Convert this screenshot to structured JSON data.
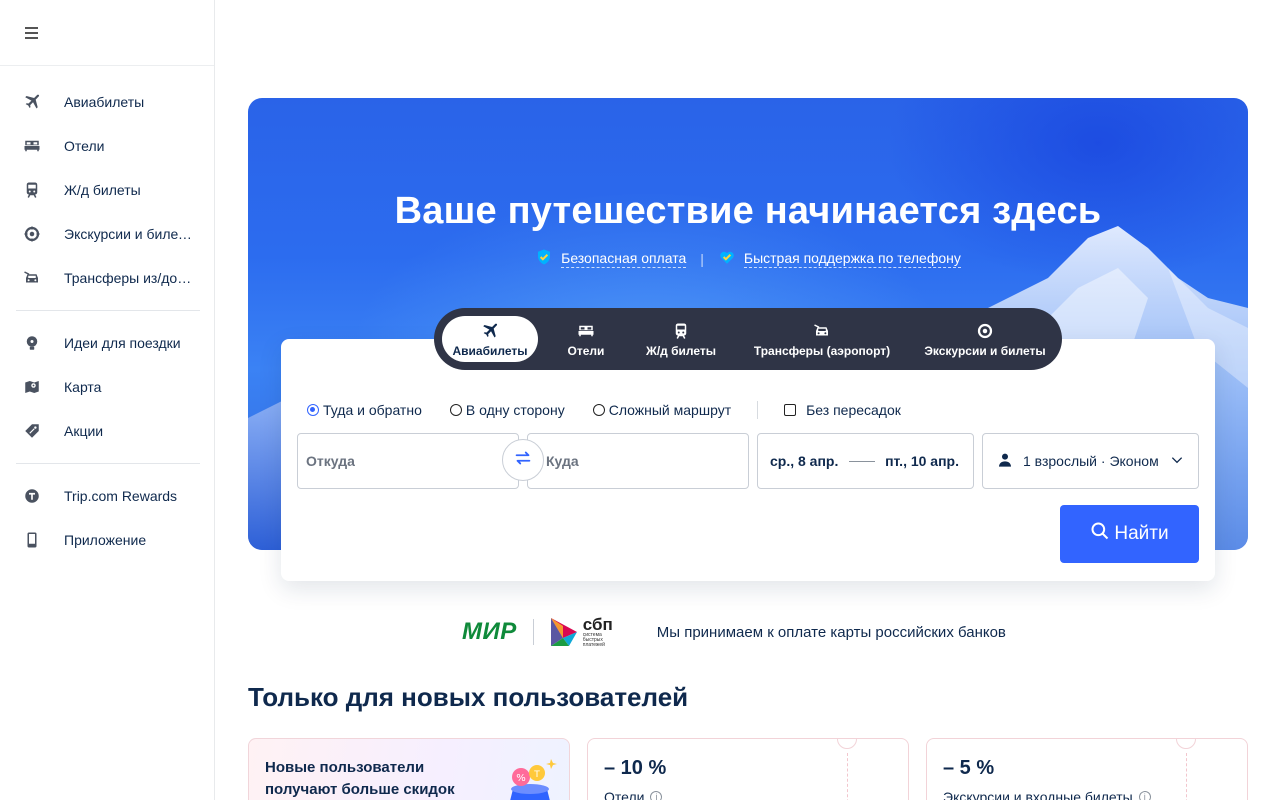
{
  "sidebar": {
    "menu_icon": "hamburger-icon",
    "items_primary": [
      {
        "label": "Авиабилеты",
        "icon": "plane-icon"
      },
      {
        "label": "Отели",
        "icon": "bed-icon"
      },
      {
        "label": "Ж/д билеты",
        "icon": "train-icon"
      },
      {
        "label": "Экскурсии и билеты",
        "icon": "attraction-icon"
      },
      {
        "label": "Трансферы из/до аэ...",
        "icon": "car-icon"
      }
    ],
    "items_secondary": [
      {
        "label": "Идеи для поездки",
        "icon": "lightbulb-icon"
      },
      {
        "label": "Карта",
        "icon": "map-icon"
      },
      {
        "label": "Акции",
        "icon": "tag-icon"
      }
    ],
    "items_tertiary": [
      {
        "label": "Trip.com Rewards",
        "icon": "rewards-icon"
      },
      {
        "label": "Приложение",
        "icon": "phone-icon"
      }
    ]
  },
  "hero": {
    "title": "Ваше путешествие начинается здесь",
    "badge1": "Безопасная оплата",
    "badge_sep": "|",
    "badge2": "Быстрая поддержка по телефону"
  },
  "tabs": [
    {
      "label": "Авиабилеты",
      "icon": "plane-icon",
      "active": true
    },
    {
      "label": "Отели",
      "icon": "bed-icon",
      "active": false
    },
    {
      "label": "Ж/д билеты",
      "icon": "train-icon",
      "active": false
    },
    {
      "label": "Трансферы (аэропорт)",
      "icon": "car-icon",
      "active": false
    },
    {
      "label": "Экскурсии и билеты",
      "icon": "attraction-icon",
      "active": false
    }
  ],
  "search": {
    "trip_types": [
      {
        "label": "Туда и обратно",
        "selected": true
      },
      {
        "label": "В одну сторону",
        "selected": false
      },
      {
        "label": "Сложный маршрут",
        "selected": false
      }
    ],
    "nonstop_label": "Без пересадок",
    "from_placeholder": "Откуда",
    "to_placeholder": "Куда",
    "depart_date": "ср., 8 апр.",
    "return_date": "пт., 10 апр.",
    "passengers": "1 взрослый · Эконом",
    "search_button": "Найти"
  },
  "payment": {
    "mir_logo_text": "МИР",
    "sbp_logo_text": "сбп",
    "sbp_logo_subtext": "система быстрых платежей",
    "caption": "Мы принимаем к оплате карты российских банков"
  },
  "new_users": {
    "title": "Только для новых пользователей",
    "promo_text": "Новые пользователи получают больше скидок",
    "coupons": [
      {
        "discount": "– 10 %",
        "category": "Отели"
      },
      {
        "discount": "– 5 %",
        "category": "Экскурсии и входные билеты"
      }
    ]
  },
  "colors": {
    "accent": "#3264ff",
    "text_primary": "#0f294d",
    "tabs_bg": "#2f3446",
    "mir_green": "#0f8a3a"
  }
}
